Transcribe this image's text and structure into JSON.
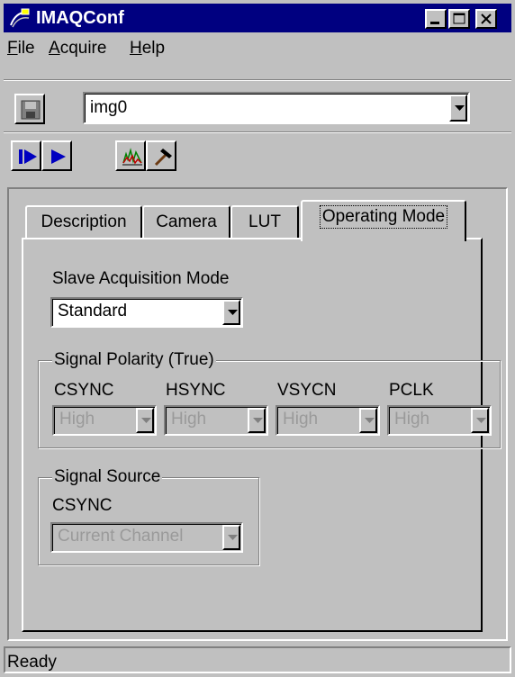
{
  "window": {
    "title": "IMAQConf",
    "colors": {
      "titlebar": "#000080",
      "face": "#c0c0c0"
    }
  },
  "menu": [
    {
      "label": "File",
      "mnemonic": "F",
      "rest": "ile"
    },
    {
      "label": "Acquire",
      "mnemonic": "A",
      "rest": "cquire"
    },
    {
      "label": "Help",
      "mnemonic": "H",
      "rest": "elp"
    }
  ],
  "device_combo": {
    "value": "img0"
  },
  "toolbar": {
    "icons": [
      "save-icon",
      "snap-icon",
      "grab-icon",
      "histogram-icon",
      "properties-icon"
    ]
  },
  "tabs": [
    {
      "label": "Description"
    },
    {
      "label": "Camera"
    },
    {
      "label": "LUT"
    },
    {
      "label": "Operating Mode",
      "active": true
    }
  ],
  "slave_mode": {
    "label": "Slave Acquisition Mode",
    "value": "Standard"
  },
  "polarity": {
    "title": "Signal Polarity (True)",
    "columns": [
      {
        "label": "CSYNC",
        "value": "High"
      },
      {
        "label": "HSYNC",
        "value": "High"
      },
      {
        "label": "VSYCN",
        "value": "High"
      },
      {
        "label": "PCLK",
        "value": "High"
      }
    ]
  },
  "source": {
    "title": "Signal Source",
    "label": "CSYNC",
    "value": "Current Channel"
  },
  "status": {
    "text": "Ready"
  }
}
